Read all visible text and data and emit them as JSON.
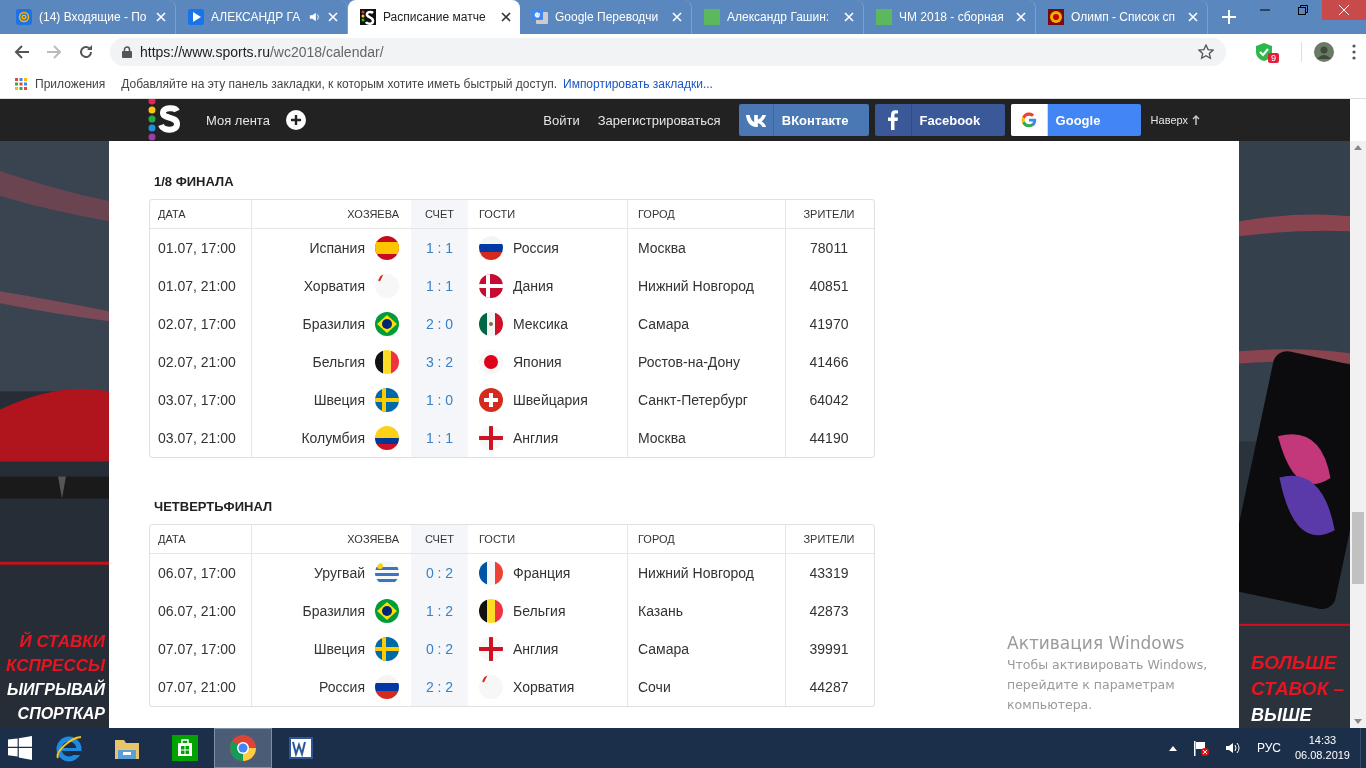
{
  "browser": {
    "tabs": [
      {
        "title": "(14) Входящие - По",
        "kind": "mail",
        "audio": false,
        "selected": false
      },
      {
        "title": "АЛЕКСАНДР ГА",
        "kind": "video",
        "audio": true,
        "selected": false
      },
      {
        "title": "Расписание матче",
        "kind": "sports",
        "audio": false,
        "selected": true
      },
      {
        "title": "Google Переводчи",
        "kind": "translate",
        "audio": false,
        "selected": false
      },
      {
        "title": "Александр Гашин:",
        "kind": "green",
        "audio": false,
        "selected": false
      },
      {
        "title": "ЧМ 2018 - сборная",
        "kind": "green",
        "audio": false,
        "selected": false
      },
      {
        "title": "Олимп - Список сп",
        "kind": "olimp",
        "audio": false,
        "selected": false
      }
    ],
    "url_host": "https://www.sports.ru",
    "url_path": "/wc2018/calendar/",
    "extension_badge": "9",
    "bookmarks": {
      "apps": "Приложения",
      "hint": "Добавляйте на эту панель закладки, к которым хотите иметь быстрый доступ.",
      "import_link": "Импортировать закладки..."
    }
  },
  "site_header": {
    "my_feed": "Моя лента",
    "login": "Войти",
    "register": "Зарегистрироваться",
    "social": [
      {
        "kind": "vk",
        "label": "ВКонтакте"
      },
      {
        "kind": "facebook",
        "label": "Facebook"
      },
      {
        "kind": "google",
        "label": "Google"
      }
    ],
    "to_top": "Наверх"
  },
  "left_ad": {
    "lines": [
      {
        "text": "Й СТАВКИ",
        "kind": "accent"
      },
      {
        "text": "КСПРЕССЫ",
        "kind": "accent"
      },
      {
        "text": "ЫИГРЫВАЙ",
        "kind": "plain"
      },
      {
        "text": "СПОРТКАР",
        "kind": "plain"
      }
    ]
  },
  "right_ad": {
    "lines": [
      {
        "text": "БОЛЬШЕ",
        "kind": "accent"
      },
      {
        "text": "СТАВОК –",
        "kind": "accent"
      },
      {
        "text": "ВЫШЕ",
        "kind": "plain"
      }
    ]
  },
  "sections": [
    {
      "title": "1/8 ФИНАЛА",
      "columns": [
        "ДАТА",
        "ХОЗЯЕВА",
        "СЧЕТ",
        "ГОСТИ",
        "ГОРОД",
        "ЗРИТЕЛИ"
      ],
      "rows": [
        {
          "date": "01.07, 17:00",
          "home": {
            "name": "Испания",
            "kind": "es"
          },
          "score": "1 : 1",
          "away": {
            "name": "Россия",
            "kind": "ru"
          },
          "city": "Москва",
          "attendance": "78011"
        },
        {
          "date": "01.07, 21:00",
          "home": {
            "name": "Хорватия",
            "kind": "hr"
          },
          "score": "1 : 1",
          "away": {
            "name": "Дания",
            "kind": "dk"
          },
          "city": "Нижний Новгород",
          "attendance": "40851"
        },
        {
          "date": "02.07, 17:00",
          "home": {
            "name": "Бразилия",
            "kind": "br"
          },
          "score": "2 : 0",
          "away": {
            "name": "Мексика",
            "kind": "mx"
          },
          "city": "Самара",
          "attendance": "41970"
        },
        {
          "date": "02.07, 21:00",
          "home": {
            "name": "Бельгия",
            "kind": "be"
          },
          "score": "3 : 2",
          "away": {
            "name": "Япония",
            "kind": "jp"
          },
          "city": "Ростов-на-Дону",
          "attendance": "41466"
        },
        {
          "date": "03.07, 17:00",
          "home": {
            "name": "Швеция",
            "kind": "se"
          },
          "score": "1 : 0",
          "away": {
            "name": "Швейцария",
            "kind": "ch"
          },
          "city": "Санкт-Петербург",
          "attendance": "64042"
        },
        {
          "date": "03.07, 21:00",
          "home": {
            "name": "Колумбия",
            "kind": "co"
          },
          "score": "1 : 1",
          "away": {
            "name": "Англия",
            "kind": "en"
          },
          "city": "Москва",
          "attendance": "44190"
        }
      ]
    },
    {
      "title": "ЧЕТВЕРТЬФИНАЛ",
      "columns": [
        "ДАТА",
        "ХОЗЯЕВА",
        "СЧЕТ",
        "ГОСТИ",
        "ГОРОД",
        "ЗРИТЕЛИ"
      ],
      "rows": [
        {
          "date": "06.07, 17:00",
          "home": {
            "name": "Уругвай",
            "kind": "uy"
          },
          "score": "0 : 2",
          "away": {
            "name": "Франция",
            "kind": "fr"
          },
          "city": "Нижний Новгород",
          "attendance": "43319"
        },
        {
          "date": "06.07, 21:00",
          "home": {
            "name": "Бразилия",
            "kind": "br"
          },
          "score": "1 : 2",
          "away": {
            "name": "Бельгия",
            "kind": "be"
          },
          "city": "Казань",
          "attendance": "42873"
        },
        {
          "date": "07.07, 17:00",
          "home": {
            "name": "Швеция",
            "kind": "se"
          },
          "score": "0 : 2",
          "away": {
            "name": "Англия",
            "kind": "en"
          },
          "city": "Самара",
          "attendance": "39991"
        },
        {
          "date": "07.07, 21:00",
          "home": {
            "name": "Россия",
            "kind": "ru"
          },
          "score": "2 : 2",
          "away": {
            "name": "Хорватия",
            "kind": "hr"
          },
          "city": "Сочи",
          "attendance": "44287"
        }
      ]
    }
  ],
  "activation": {
    "title": "Активация Windows",
    "text": "Чтобы активировать Windows, перейдите к параметрам компьютера."
  },
  "taskbar": {
    "apps": [
      {
        "kind": "ie",
        "selected": false
      },
      {
        "kind": "explorer",
        "selected": false
      },
      {
        "kind": "store",
        "selected": false
      },
      {
        "kind": "chrome",
        "selected": true
      },
      {
        "kind": "word",
        "selected": false
      }
    ],
    "language": "РУС",
    "time": "14:33",
    "date": "06.08.2019"
  }
}
